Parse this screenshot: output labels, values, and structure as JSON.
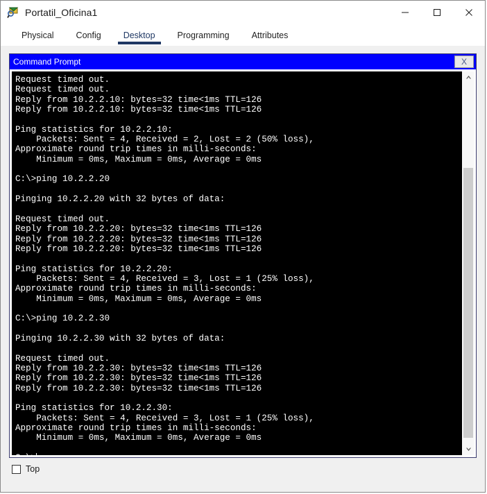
{
  "window": {
    "title": "Portatil_Oficina1",
    "icon": "packet-tracer-device-icon",
    "controls": {
      "minimize": "minimize-icon",
      "maximize": "maximize-icon",
      "close": "close-icon"
    }
  },
  "tabs": [
    {
      "label": "Physical",
      "active": false
    },
    {
      "label": "Config",
      "active": false
    },
    {
      "label": "Desktop",
      "active": true
    },
    {
      "label": "Programming",
      "active": false
    },
    {
      "label": "Attributes",
      "active": false
    }
  ],
  "command_prompt": {
    "title": "Command Prompt",
    "close_label": "X",
    "accent_color": "#0000ff",
    "terminal_bg": "#000000",
    "terminal_fg": "#ffffff",
    "lines": [
      "Request timed out.",
      "Request timed out.",
      "Reply from 10.2.2.10: bytes=32 time<1ms TTL=126",
      "Reply from 10.2.2.10: bytes=32 time<1ms TTL=126",
      "",
      "Ping statistics for 10.2.2.10:",
      "    Packets: Sent = 4, Received = 2, Lost = 2 (50% loss),",
      "Approximate round trip times in milli-seconds:",
      "    Minimum = 0ms, Maximum = 0ms, Average = 0ms",
      "",
      "C:\\>ping 10.2.2.20",
      "",
      "Pinging 10.2.2.20 with 32 bytes of data:",
      "",
      "Request timed out.",
      "Reply from 10.2.2.20: bytes=32 time<1ms TTL=126",
      "Reply from 10.2.2.20: bytes=32 time<1ms TTL=126",
      "Reply from 10.2.2.20: bytes=32 time<1ms TTL=126",
      "",
      "Ping statistics for 10.2.2.20:",
      "    Packets: Sent = 4, Received = 3, Lost = 1 (25% loss),",
      "Approximate round trip times in milli-seconds:",
      "    Minimum = 0ms, Maximum = 0ms, Average = 0ms",
      "",
      "C:\\>ping 10.2.2.30",
      "",
      "Pinging 10.2.2.30 with 32 bytes of data:",
      "",
      "Request timed out.",
      "Reply from 10.2.2.30: bytes=32 time<1ms TTL=126",
      "Reply from 10.2.2.30: bytes=32 time<1ms TTL=126",
      "Reply from 10.2.2.30: bytes=32 time<1ms TTL=126",
      "",
      "Ping statistics for 10.2.2.30:",
      "    Packets: Sent = 4, Received = 3, Lost = 1 (25% loss),",
      "Approximate round trip times in milli-seconds:",
      "    Minimum = 0ms, Maximum = 0ms, Average = 0ms",
      "",
      "C:\\>"
    ],
    "prompt_line": "C:\\>",
    "scrollbar": {
      "up_icon": "chevron-up-icon",
      "down_icon": "chevron-down-icon",
      "thumb_top_percent": 23.5,
      "thumb_bottom_percent": 1.5
    }
  },
  "footer": {
    "checkbox_label": "Top",
    "checked": false
  }
}
